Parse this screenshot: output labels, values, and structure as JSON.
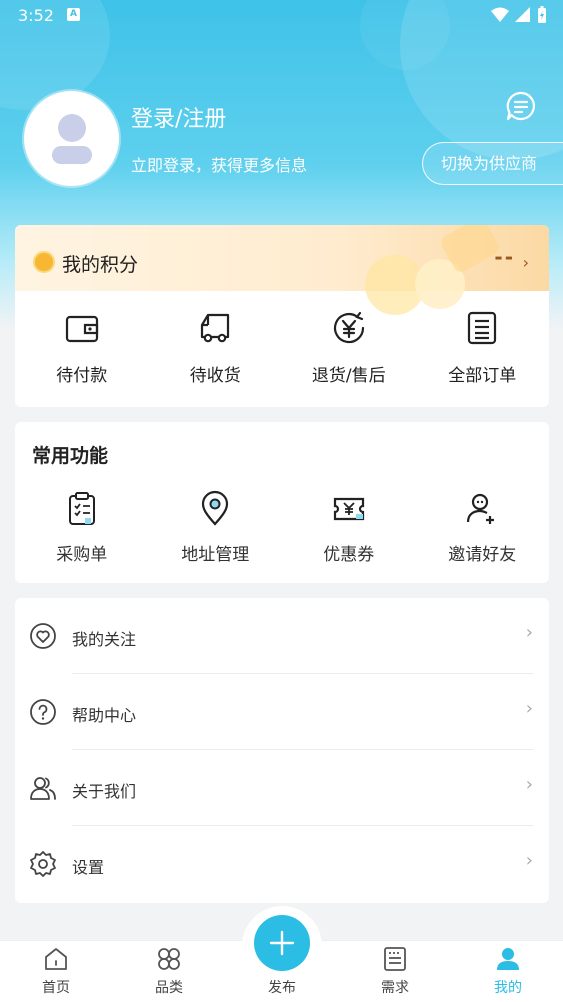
{
  "statusbar": {
    "time": "3:52",
    "indicator": "A"
  },
  "profile": {
    "title": "登录/注册",
    "subtitle": "立即登录，获得更多信息",
    "switch_label": "切换为供应商"
  },
  "points": {
    "label": "我的积分",
    "value": "--"
  },
  "orders": [
    {
      "label": "待付款",
      "icon": "wallet-icon"
    },
    {
      "label": "待收货",
      "icon": "truck-icon"
    },
    {
      "label": "退货/售后",
      "icon": "yen-refund-icon"
    },
    {
      "label": "全部订单",
      "icon": "clipboard-list-icon"
    }
  ],
  "functions": {
    "title": "常用功能",
    "items": [
      {
        "label": "采购单",
        "icon": "purchase-list-icon"
      },
      {
        "label": "地址管理",
        "icon": "location-pin-icon"
      },
      {
        "label": "优惠券",
        "icon": "coupon-icon"
      },
      {
        "label": "邀请好友",
        "icon": "invite-user-icon"
      }
    ]
  },
  "menu": [
    {
      "label": "我的关注",
      "icon": "heart-circle-icon"
    },
    {
      "label": "帮助中心",
      "icon": "help-circle-icon"
    },
    {
      "label": "关于我们",
      "icon": "users-icon"
    },
    {
      "label": "设置",
      "icon": "gear-icon"
    }
  ],
  "tabbar": {
    "items": [
      {
        "label": "首页",
        "icon": "home-icon"
      },
      {
        "label": "品类",
        "icon": "category-icon"
      },
      {
        "label": "发布",
        "icon": "plus-icon"
      },
      {
        "label": "需求",
        "icon": "demand-icon"
      },
      {
        "label": "我的",
        "icon": "user-icon"
      }
    ],
    "active_color": "#2bbde3"
  },
  "colors": {
    "accent": "#2bbde3",
    "header": "#3ec2e8"
  }
}
